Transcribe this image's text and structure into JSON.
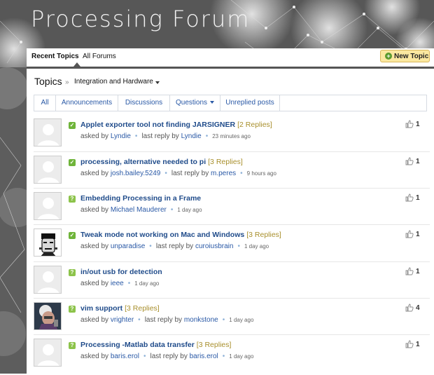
{
  "app": {
    "title": "Processing Forum"
  },
  "nav": {
    "tabs": [
      "Recent Topics",
      "All Forums"
    ],
    "new_topic": "New Topic"
  },
  "section": {
    "title": "Topics",
    "breadcrumb": "Integration and Hardware"
  },
  "filters": [
    "All",
    "Announcements",
    "Discussions",
    "Questions",
    "Unreplied posts"
  ],
  "labels": {
    "asked_by": "asked by",
    "last_reply_by": "last reply by"
  },
  "topics": [
    {
      "title": "Applet exporter tool not finding JARSIGNER",
      "replies": "[2 Replies]",
      "asker": "Lyndie",
      "last_reply": "Lyndie",
      "time": "23 minutes ago",
      "likes": "1",
      "status": "answered",
      "avatar": "default"
    },
    {
      "title": "processing, alternative needed to pi",
      "replies": "[3 Replies]",
      "asker": "josh.bailey.5249",
      "last_reply": "m.peres",
      "time": "9 hours ago",
      "likes": "1",
      "status": "answered",
      "avatar": "default"
    },
    {
      "title": "Embedding Processing in a Frame",
      "replies": "",
      "asker": "Michael Mauderer",
      "last_reply": "",
      "time": "1 day ago",
      "likes": "1",
      "status": "question",
      "avatar": "default"
    },
    {
      "title": "Tweak mode not working on Mac and Windows",
      "replies": "[3 Replies]",
      "asker": "unparadise",
      "last_reply": "curoiusbrain",
      "time": "1 day ago",
      "likes": "1",
      "status": "answered",
      "avatar": "frankenstein"
    },
    {
      "title": "in/out usb for detection",
      "replies": "",
      "asker": "ieee",
      "last_reply": "",
      "time": "1 day ago",
      "likes": "1",
      "status": "question",
      "avatar": "default"
    },
    {
      "title": "vim support",
      "replies": "[3 Replies]",
      "asker": "vrighter",
      "last_reply": "monkstone",
      "time": "1 day ago",
      "likes": "4",
      "status": "question",
      "avatar": "photo"
    },
    {
      "title": "Processing -Matlab data transfer",
      "replies": "[3 Replies]",
      "asker": "baris.erol",
      "last_reply": "baris.erol",
      "time": "1 day ago",
      "likes": "1",
      "status": "question",
      "avatar": "default"
    }
  ]
}
